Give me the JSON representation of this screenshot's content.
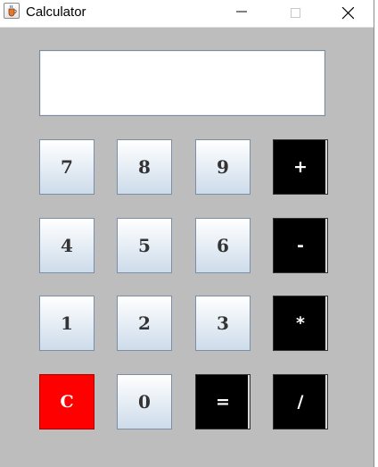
{
  "window": {
    "title": "Calculator",
    "icon": "java-cup-icon",
    "controls": [
      "minimize-icon",
      "maximize-icon",
      "close-icon"
    ]
  },
  "display": {
    "value": ""
  },
  "keys": {
    "row1": [
      "7",
      "8",
      "9",
      "+"
    ],
    "row2": [
      "4",
      "5",
      "6",
      "-"
    ],
    "row3": [
      "1",
      "2",
      "3",
      "*"
    ],
    "row4": [
      "C",
      "0",
      "=",
      "/"
    ]
  },
  "colors": {
    "background": "#bdbdbd",
    "operator_key": "#000000",
    "clear_key": "#ff0000",
    "number_key_top": "#ffffff",
    "number_key_bottom": "#cddbea"
  }
}
